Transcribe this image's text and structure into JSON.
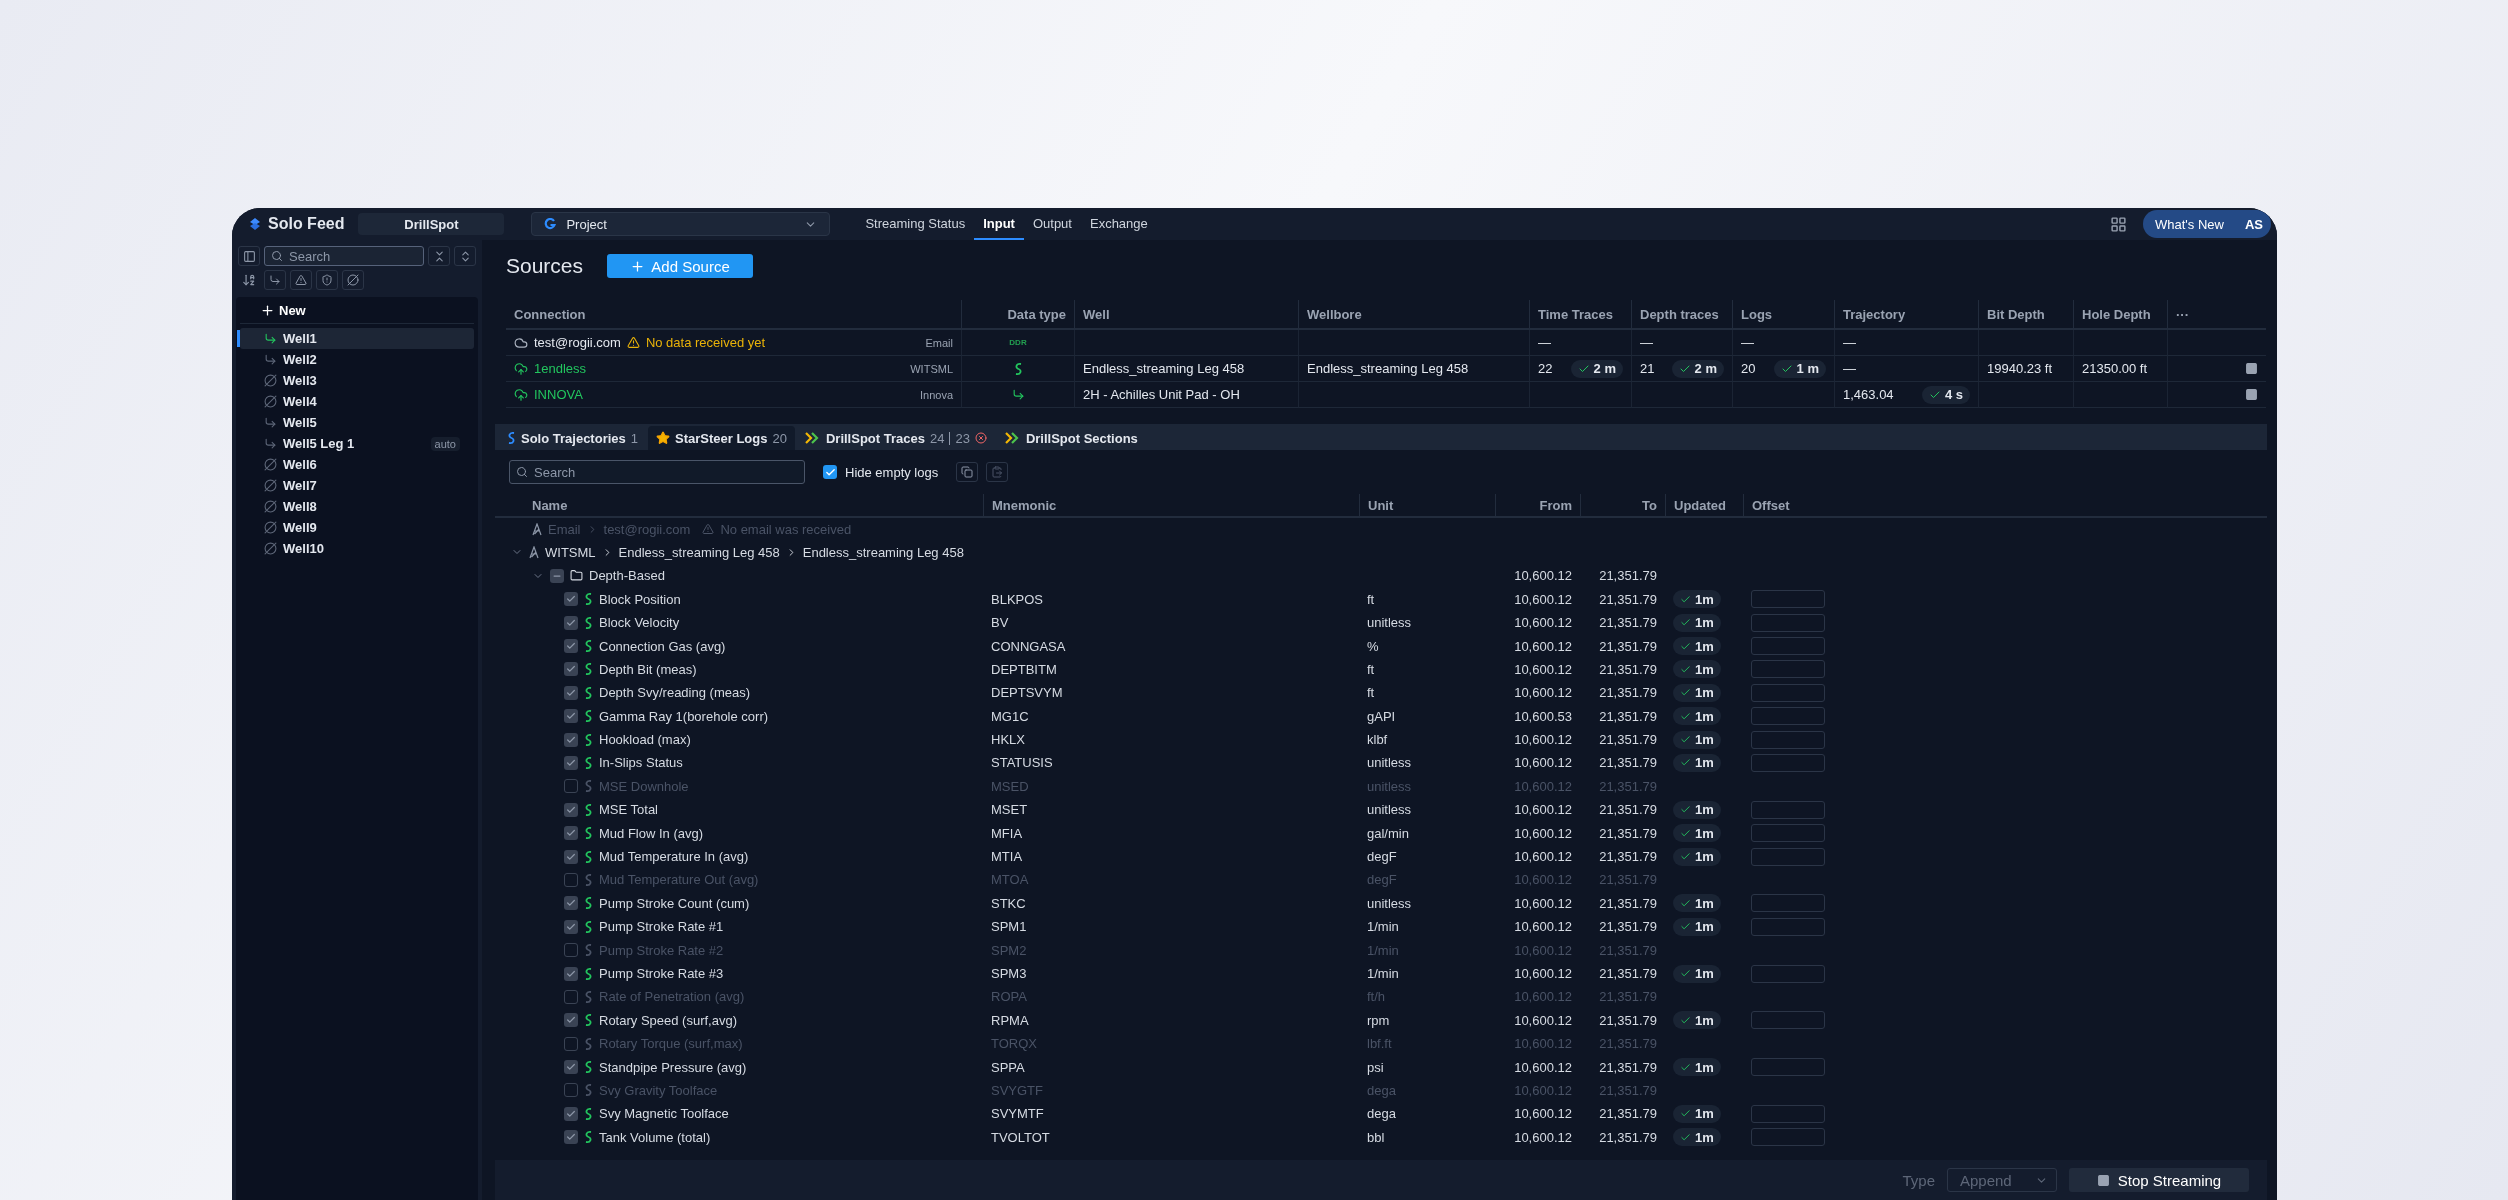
{
  "app": {
    "name": "Solo Feed",
    "workspace": "DrillSpot"
  },
  "project": {
    "label": "Project"
  },
  "nav": [
    {
      "label": "Streaming Status",
      "selected": false
    },
    {
      "label": "Input",
      "selected": true
    },
    {
      "label": "Output",
      "selected": false
    },
    {
      "label": "Exchange",
      "selected": false
    }
  ],
  "whats_new": "What's New",
  "avatar": "AS",
  "sidebar": {
    "search": {
      "placeholder": "Search"
    },
    "new": "New",
    "wells": [
      {
        "name": "Well1",
        "kind": "active",
        "selected": true
      },
      {
        "name": "Well2",
        "kind": "curve",
        "selected": false
      },
      {
        "name": "Well3",
        "kind": "none",
        "selected": false
      },
      {
        "name": "Well4",
        "kind": "none",
        "selected": false
      },
      {
        "name": "Well5",
        "kind": "curve",
        "selected": false
      },
      {
        "name": "Well5 Leg 1",
        "kind": "curve",
        "selected": false,
        "badge": "auto"
      },
      {
        "name": "Well6",
        "kind": "none",
        "selected": false
      },
      {
        "name": "Well7",
        "kind": "none",
        "selected": false
      },
      {
        "name": "Well8",
        "kind": "none",
        "selected": false
      },
      {
        "name": "Well9",
        "kind": "none",
        "selected": false
      },
      {
        "name": "Well10",
        "kind": "none",
        "selected": false
      }
    ]
  },
  "sources": {
    "title": "Sources",
    "add": "Add Source",
    "columns": [
      "Connection",
      "Data type",
      "Well",
      "Wellbore",
      "Time Traces",
      "Depth traces",
      "Logs",
      "Trajectory",
      "Bit Depth",
      "Hole Depth",
      "···"
    ],
    "rows": [
      {
        "connection": "test@rogii.com",
        "kind": "email",
        "warning": "No data received yet",
        "data_type": "Email",
        "data_badge": "DDR",
        "time_traces": {
          "value": "—"
        },
        "depth_traces": {
          "value": "—"
        },
        "logs": {
          "value": "—"
        },
        "trajectory": {
          "value": "—"
        },
        "stoppable": false
      },
      {
        "connection": "1endless",
        "kind": "witsml",
        "data_type": "WITSML",
        "well": "Endless_streaming Leg 458",
        "wellbore": "Endless_streaming Leg 458",
        "time_traces": {
          "value": "22",
          "updated": "2 m"
        },
        "depth_traces": {
          "value": "21",
          "updated": "2 m"
        },
        "logs": {
          "value": "20",
          "updated": "1 m"
        },
        "trajectory": {
          "value": "—"
        },
        "bit_depth": "19940.23 ft",
        "hole_depth": "21350.00 ft",
        "stoppable": true
      },
      {
        "connection": "INNOVA",
        "kind": "innova",
        "data_type": "Innova",
        "well": "2H - Achilles Unit Pad - OH",
        "trajectory": {
          "value": "1,463.04",
          "updated": "4 s"
        },
        "stoppable": true
      }
    ]
  },
  "log_tabs": [
    {
      "label": "Solo Trajectories",
      "count": "1",
      "kind": "solo",
      "selected": false
    },
    {
      "label": "StarSteer Logs",
      "count": "20",
      "kind": "star",
      "selected": true
    },
    {
      "label": "DrillSpot Traces",
      "count": "24",
      "count_2": "23",
      "error": true,
      "kind": "drillspot",
      "selected": false
    },
    {
      "label": "DrillSpot Sections",
      "kind": "drillspot",
      "selected": false
    }
  ],
  "logs": {
    "search": {
      "placeholder": "Search"
    },
    "hide_empty": {
      "label": "Hide empty logs",
      "checked": true
    },
    "columns": [
      "Name",
      "Mnemonic",
      "Unit",
      "From",
      "To",
      "Updated",
      "Offset"
    ],
    "tree": [
      {
        "kind": "email",
        "disabled": true,
        "path": [
          "Email",
          "test@rogii.com"
        ],
        "warning": "No email was received"
      },
      {
        "kind": "witsml",
        "disabled": false,
        "expanded": true,
        "path": [
          "WITSML",
          "Endless_streaming Leg 458",
          "Endless_streaming Leg 458"
        ],
        "children": [
          {
            "label": "Depth-Based",
            "expanded": true,
            "indeterminate": true,
            "from": "10,600.12",
            "to": "21,351.79",
            "children": [
              {
                "name": "Block Position",
                "mnemonic": "BLKPOS",
                "unit": "ft",
                "from": "10,600.12",
                "to": "21,351.79",
                "checked": true,
                "updated": "1m"
              },
              {
                "name": "Block Velocity",
                "mnemonic": "BV",
                "unit": "unitless",
                "from": "10,600.12",
                "to": "21,351.79",
                "checked": true,
                "updated": "1m"
              },
              {
                "name": "Connection Gas (avg)",
                "mnemonic": "CONNGASA",
                "unit": "%",
                "from": "10,600.12",
                "to": "21,351.79",
                "checked": true,
                "updated": "1m"
              },
              {
                "name": "Depth Bit (meas)",
                "mnemonic": "DEPTBITM",
                "unit": "ft",
                "from": "10,600.12",
                "to": "21,351.79",
                "checked": true,
                "updated": "1m"
              },
              {
                "name": "Depth Svy/reading (meas)",
                "mnemonic": "DEPTSVYM",
                "unit": "ft",
                "from": "10,600.12",
                "to": "21,351.79",
                "checked": true,
                "updated": "1m"
              },
              {
                "name": "Gamma Ray 1(borehole corr)",
                "mnemonic": "MG1C",
                "unit": "gAPI",
                "from": "10,600.53",
                "to": "21,351.79",
                "checked": true,
                "updated": "1m"
              },
              {
                "name": "Hookload (max)",
                "mnemonic": "HKLX",
                "unit": "klbf",
                "from": "10,600.12",
                "to": "21,351.79",
                "checked": true,
                "updated": "1m"
              },
              {
                "name": "In-Slips Status",
                "mnemonic": "STATUSIS",
                "unit": "unitless",
                "from": "10,600.12",
                "to": "21,351.79",
                "checked": true,
                "updated": "1m"
              },
              {
                "name": "MSE Downhole",
                "mnemonic": "MSED",
                "unit": "unitless",
                "from": "10,600.12",
                "to": "21,351.79",
                "checked": false
              },
              {
                "name": "MSE Total",
                "mnemonic": "MSET",
                "unit": "unitless",
                "from": "10,600.12",
                "to": "21,351.79",
                "checked": true,
                "updated": "1m"
              },
              {
                "name": "Mud Flow In (avg)",
                "mnemonic": "MFIA",
                "unit": "gal/min",
                "from": "10,600.12",
                "to": "21,351.79",
                "checked": true,
                "updated": "1m"
              },
              {
                "name": "Mud Temperature In (avg)",
                "mnemonic": "MTIA",
                "unit": "degF",
                "from": "10,600.12",
                "to": "21,351.79",
                "checked": true,
                "updated": "1m"
              },
              {
                "name": "Mud Temperature Out (avg)",
                "mnemonic": "MTOA",
                "unit": "degF",
                "from": "10,600.12",
                "to": "21,351.79",
                "checked": false
              },
              {
                "name": "Pump Stroke Count (cum)",
                "mnemonic": "STKC",
                "unit": "unitless",
                "from": "10,600.12",
                "to": "21,351.79",
                "checked": true,
                "updated": "1m"
              },
              {
                "name": "Pump Stroke Rate #1",
                "mnemonic": "SPM1",
                "unit": "1/min",
                "from": "10,600.12",
                "to": "21,351.79",
                "checked": true,
                "updated": "1m"
              },
              {
                "name": "Pump Stroke Rate #2",
                "mnemonic": "SPM2",
                "unit": "1/min",
                "from": "10,600.12",
                "to": "21,351.79",
                "checked": false
              },
              {
                "name": "Pump Stroke Rate #3",
                "mnemonic": "SPM3",
                "unit": "1/min",
                "from": "10,600.12",
                "to": "21,351.79",
                "checked": true,
                "updated": "1m"
              },
              {
                "name": "Rate of Penetration (avg)",
                "mnemonic": "ROPA",
                "unit": "ft/h",
                "from": "10,600.12",
                "to": "21,351.79",
                "checked": false
              },
              {
                "name": "Rotary Speed (surf,avg)",
                "mnemonic": "RPMA",
                "unit": "rpm",
                "from": "10,600.12",
                "to": "21,351.79",
                "checked": true,
                "updated": "1m"
              },
              {
                "name": "Rotary Torque (surf,max)",
                "mnemonic": "TORQX",
                "unit": "lbf.ft",
                "from": "10,600.12",
                "to": "21,351.79",
                "checked": false
              },
              {
                "name": "Standpipe Pressure (avg)",
                "mnemonic": "SPPA",
                "unit": "psi",
                "from": "10,600.12",
                "to": "21,351.79",
                "checked": true,
                "updated": "1m"
              },
              {
                "name": "Svy Gravity Toolface",
                "mnemonic": "SVYGTF",
                "unit": "dega",
                "from": "10,600.12",
                "to": "21,351.79",
                "checked": false
              },
              {
                "name": "Svy Magnetic Toolface",
                "mnemonic": "SVYMTF",
                "unit": "dega",
                "from": "10,600.12",
                "to": "21,351.79",
                "checked": true,
                "updated": "1m"
              },
              {
                "name": "Tank Volume (total)",
                "mnemonic": "TVOLTOT",
                "unit": "bbl",
                "from": "10,600.12",
                "to": "21,351.79",
                "checked": true,
                "updated": "1m"
              }
            ]
          }
        ]
      }
    ]
  },
  "footer": {
    "type_label": "Type",
    "type_value": "Append",
    "stop": "Stop Streaming"
  }
}
